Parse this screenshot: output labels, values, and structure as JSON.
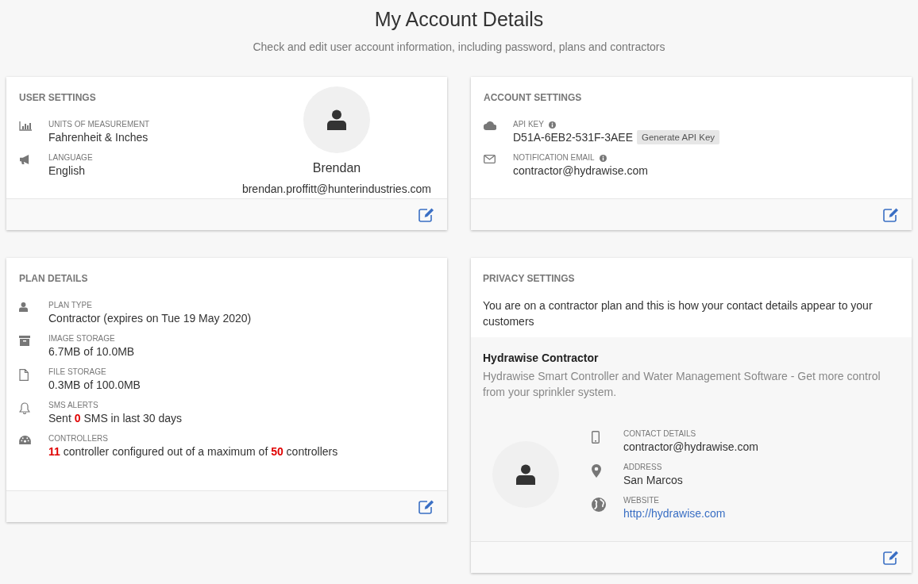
{
  "header": {
    "title": "My Account Details",
    "subtitle": "Check and edit user account information, including password, plans and contractors"
  },
  "user_settings": {
    "title": "USER SETTINGS",
    "fields": [
      {
        "kind": "chart",
        "label": "UNITS OF MEASUREMENT",
        "value": "Fahrenheit & Inches"
      },
      {
        "kind": "megaphone",
        "label": "LANGUAGE",
        "value": "English"
      }
    ],
    "profile": {
      "name": "Brendan",
      "email": "brendan.proffitt@hunterindustries.com"
    }
  },
  "account_settings": {
    "title": "ACCOUNT SETTINGS",
    "fields": [
      {
        "kind": "cloud",
        "label": "API KEY",
        "info": true,
        "value": "D51A-6EB2-531F-3AEE",
        "button": "Generate API Key"
      },
      {
        "kind": "envelope",
        "label": "NOTIFICATION EMAIL",
        "info": true,
        "value": "contractor@hydrawise.com"
      }
    ]
  },
  "plan_details": {
    "title": "PLAN DETAILS",
    "fields": [
      {
        "kind": "user",
        "label": "PLAN TYPE",
        "value": "Contractor (expires on Tue 19 May 2020)"
      },
      {
        "kind": "archive",
        "label": "IMAGE STORAGE",
        "value": "6.7MB of 10.0MB"
      },
      {
        "kind": "file",
        "label": "FILE STORAGE",
        "value": "0.3MB of 100.0MB"
      },
      {
        "kind": "bell",
        "label": "SMS ALERTS",
        "value": "Sent **0** SMS in last 30 days"
      },
      {
        "kind": "gauge",
        "label": "CONTROLLERS",
        "value": "**11** controller configured out of a maximum of **50** controllers"
      }
    ]
  },
  "privacy_settings": {
    "title": "PRIVACY SETTINGS",
    "intro": "You are on a contractor plan and this is how your contact details appear to your customers",
    "company": "Hydrawise Contractor",
    "description": "Hydrawise Smart Controller and Water Management Software - Get more control from your sprinkler system.",
    "fields": [
      {
        "kind": "phone",
        "label": "CONTACT DETAILS",
        "value": "contractor@hydrawise.com"
      },
      {
        "kind": "pin",
        "label": "ADDRESS",
        "value": "San Marcos"
      },
      {
        "kind": "globe",
        "label": "WEBSITE",
        "value": "http://hydrawise.com",
        "link": true
      }
    ]
  }
}
